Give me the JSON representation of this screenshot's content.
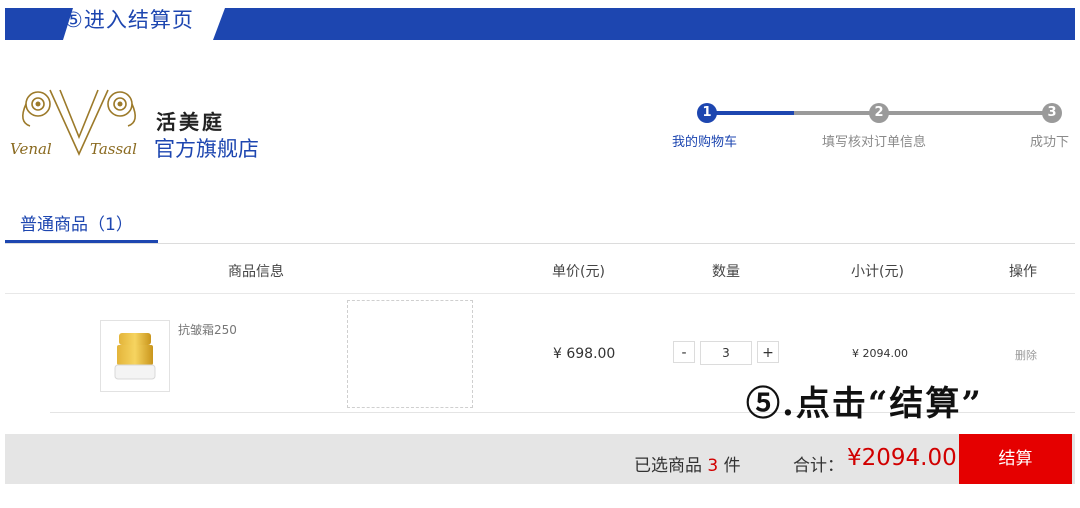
{
  "banner": {
    "title": "⑤进入结算页"
  },
  "brand": {
    "name": "活美庭",
    "store": "官方旗舰店",
    "logo_text": "Venal V Tassal"
  },
  "steps": [
    {
      "num": "1",
      "label": "我的购物车",
      "active": true
    },
    {
      "num": "2",
      "label": "填写核对订单信息",
      "active": false
    },
    {
      "num": "3",
      "label": "成功下",
      "active": false
    }
  ],
  "colors": {
    "accent": "#1d46b0",
    "price_red": "#d10000",
    "checkout": "#e50000",
    "inactive": "#9a9a9a"
  },
  "cart": {
    "tab_label": "普通商品（1）",
    "headers": {
      "info": "商品信息",
      "unit_price": "单价(元)",
      "quantity": "数量",
      "subtotal": "小计(元)",
      "action": "操作"
    },
    "items": [
      {
        "name": "抗皱霜250",
        "unit_price": "¥ 698.00",
        "qty_minus": "-",
        "quantity": "3",
        "qty_plus": "+",
        "subtotal": "¥ 2094.00",
        "delete": "删除"
      }
    ]
  },
  "annotation": "⑤.点击“结算”",
  "footer": {
    "selected_prefix": "已选商品",
    "selected_count": "3",
    "selected_suffix": "件",
    "total_label": "合计：",
    "total_value": "¥2094.00",
    "checkout_label": "结算"
  }
}
